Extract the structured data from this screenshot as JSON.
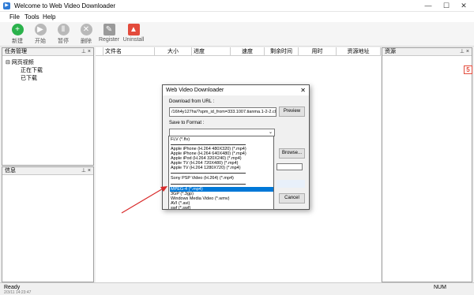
{
  "window": {
    "title": "Welcome to Web Video Downloader",
    "minimize": "—",
    "maximize": "☐",
    "close": "✕"
  },
  "menu": [
    "File",
    "Tools",
    "Help"
  ],
  "toolbar": [
    {
      "label": "新建",
      "icon": "+",
      "color": "#2bb24c"
    },
    {
      "label": "开始",
      "icon": "▶",
      "color": "#b9b9b9"
    },
    {
      "label": "暂停",
      "icon": "Ⅱ",
      "color": "#b9b9b9"
    },
    {
      "label": "删除",
      "icon": "✕",
      "color": "#b9b9b9"
    },
    {
      "label": "Register",
      "icon": "✎",
      "color": "#9a9a9a"
    },
    {
      "label": "Uninstall",
      "icon": "▲",
      "color": "#e34b3c"
    }
  ],
  "task_panel": {
    "title": "任务管理",
    "pin": "⊥ ×",
    "root": "网页视频",
    "children": [
      "正在下载",
      "已下载"
    ]
  },
  "info_panel": {
    "title": "信息",
    "pin": "⊥ ×"
  },
  "resource_panel": {
    "title": "资源",
    "pin": "⊥ ×"
  },
  "grid_columns": [
    "文件名",
    "大小",
    "进度",
    "速度",
    "剩余时间",
    "用时",
    "资源地址"
  ],
  "dialog": {
    "title": "Web Video Downloader",
    "close": "✕",
    "url_label": "Download from URL :",
    "url_value": "/16h4y127hs/?spm_id_from=333.1007.tianma.1-2-2.click",
    "preview": "Preview",
    "format_label": "Save to Format :",
    "browse": "Browse...",
    "cancel": "Cancel"
  },
  "format_options": [
    "FLV (*.flv)",
    "Apple iPhone  (H.264 480X320) (*.mp4)",
    "Apple iPhone  (H.264 640X480) (*.mp4)",
    "Apple iPod  (H.264 320X240) (*.mp4)",
    "Apple TV  (H.264 720X480) (*.mp4)",
    "Apple TV  (H.264 1280X720) (*.mp4)",
    "Sony PSP Video  (H.264) (*.mp4)",
    "MPEG-4 (*.mp4)",
    "3GP (*.3gp)",
    "Windows Media Video (*.wmv)",
    "AVI (*.avi)",
    "swf (*.swf)"
  ],
  "selected_format": "MPEG-4 (*.mp4)",
  "status": {
    "left": "Ready",
    "right": "NUM",
    "bottom_text": "2/3/11 14:23:47"
  },
  "badge": "5"
}
